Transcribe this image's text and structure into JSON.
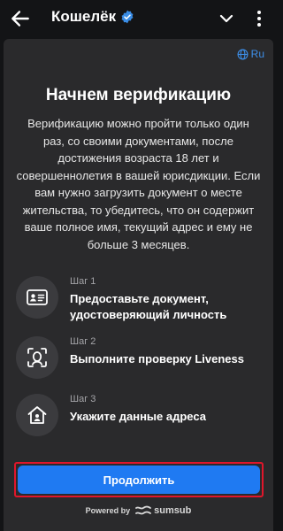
{
  "header": {
    "title": "Кошелёк"
  },
  "language": {
    "label": "Ru"
  },
  "main": {
    "heading": "Начнем верификацию",
    "intro": "Верификацию можно пройти только один раз, со своими документами, после достижения возраста 18 лет и совершеннолетия в вашей юрисдикции. Если вам нужно загрузить документ о месте жительства, то убедитесь, что он содержит ваше полное имя, текущий адрес и ему не больше 3 месяцев.",
    "steps": [
      {
        "number": "Шаг 1",
        "text": "Предоставьте документ, удостоверяющий личность",
        "icon": "id-card-icon"
      },
      {
        "number": "Шаг 2",
        "text": "Выполните проверку Liveness",
        "icon": "face-scan-icon"
      },
      {
        "number": "Шаг 3",
        "text": "Укажите данные адреса",
        "icon": "home-icon"
      }
    ],
    "continue_label": "Продолжить"
  },
  "footer": {
    "powered_by": "Powered by",
    "brand": "sumsub"
  },
  "colors": {
    "accent": "#1f7af2",
    "highlight": "#e0162b",
    "background": "#131416",
    "card": "#2a2a2c",
    "verified_badge": "#3a8de6"
  }
}
